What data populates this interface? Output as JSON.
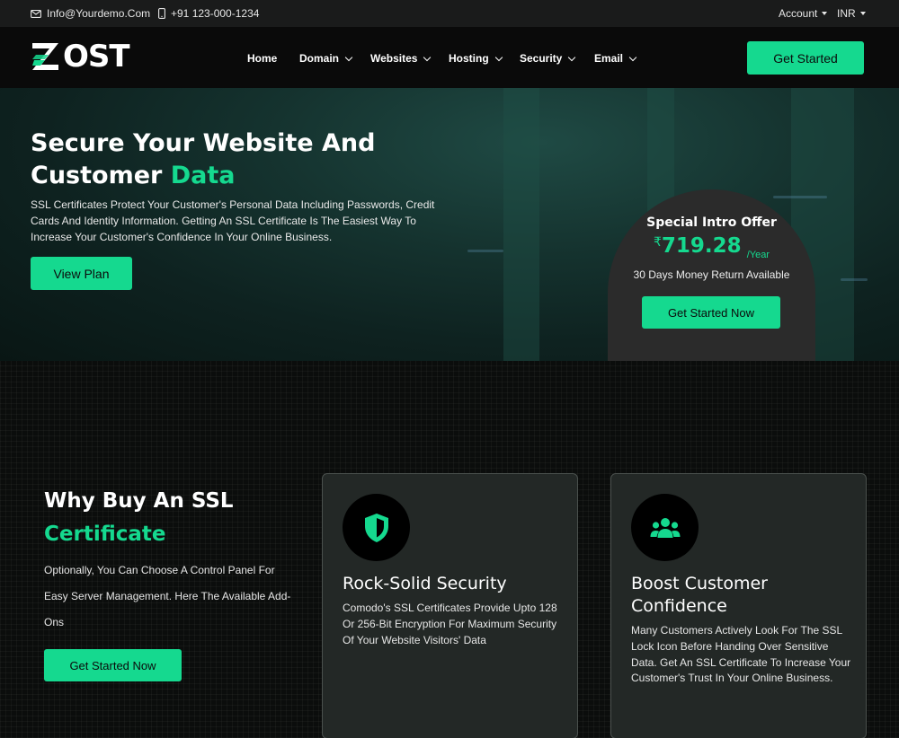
{
  "topbar": {
    "email": "Info@Yourdemo.Com",
    "phone": "+91 123-000-1234",
    "account_label": "Account",
    "currency_label": "INR"
  },
  "nav": {
    "logo_text": "OST",
    "items": [
      {
        "label": "Home"
      },
      {
        "label": "Domain"
      },
      {
        "label": "Websites"
      },
      {
        "label": "Hosting"
      },
      {
        "label": "Security"
      },
      {
        "label": "Email"
      }
    ],
    "cta_label": "Get Started"
  },
  "hero": {
    "title_line1": "Secure Your Website And",
    "title_line2_prefix": "Customer ",
    "title_line2_accent": "Data",
    "description": "SSL Certificates Protect Your Customer's Personal Data Including Passwords, Credit Cards And Identity Information. Getting An SSL Certificate Is The Easiest Way To Increase Your Customer's Confidence In Your Online Business.",
    "button_label": "View Plan"
  },
  "offer": {
    "title": "Special Intro Offer",
    "currency_symbol": "₹",
    "amount": "719.28",
    "period": "/Year",
    "guarantee": "30 Days Money Return Available",
    "button_label": "Get Started Now"
  },
  "why": {
    "title_line1": "Why Buy An SSL",
    "title_line2": "Certificate",
    "description": "Optionally, You Can Choose A Control Panel For Easy Server Management. Here The Available Add-Ons",
    "button_label": "Get Started Now"
  },
  "features": [
    {
      "icon": "shield-icon",
      "title": "Rock-Solid Security",
      "text": "Comodo's SSL Certificates Provide Upto 128 Or 256-Bit Encryption For Maximum Security Of Your Website Visitors' Data"
    },
    {
      "icon": "users-icon",
      "title": "Boost Customer Confidence",
      "text": "Many Customers Actively Look For The SSL Lock Icon Before Handing Over Sensitive Data. Get An SSL Certificate To Increase Your Customer's Trust In Your Online Business."
    }
  ],
  "colors": {
    "accent": "#15d98f",
    "card_bg": "#232826",
    "offer_bg": "#2b2b2b"
  }
}
